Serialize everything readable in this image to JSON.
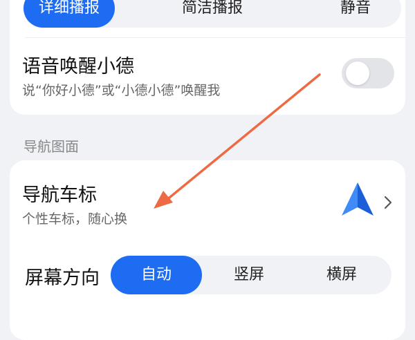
{
  "top_segment": {
    "options": [
      "详细播报",
      "简洁播报",
      "静音"
    ],
    "selected": "详细播报"
  },
  "voice_wake": {
    "title": "语音唤醒小德",
    "subtitle": "说“你好小德”或“小德小德”唤醒我",
    "enabled": false
  },
  "section": {
    "label": "导航图面"
  },
  "nav_icon": {
    "title": "导航车标",
    "subtitle": "个性车标，随心换"
  },
  "screen_orientation": {
    "label": "屏幕方向",
    "options": [
      "自动",
      "竖屏",
      "横屏"
    ],
    "selected": "自动"
  },
  "colors": {
    "accent": "#1e6cf2",
    "annotation_arrow": "#ee6a45",
    "background": "#f1f2f6",
    "card": "#ffffff"
  }
}
